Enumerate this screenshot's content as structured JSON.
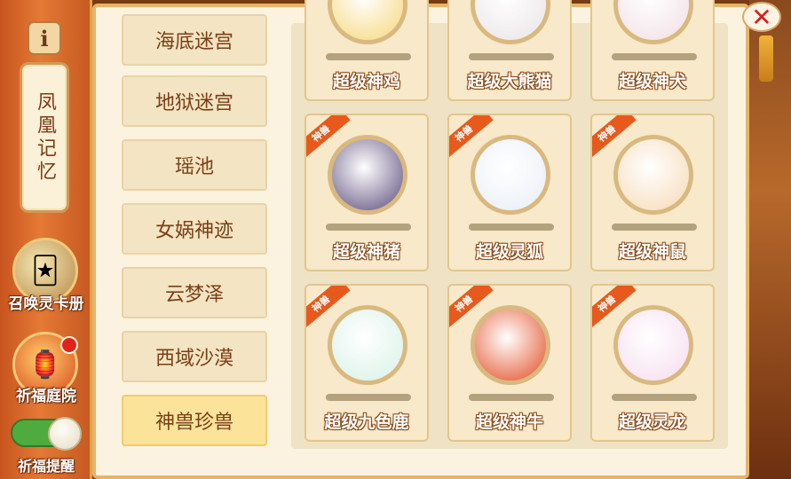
{
  "sidebar": {
    "info_icon": "info-icon",
    "scroll_title": "凤凰记忆",
    "card_book_label": "召唤灵卡册",
    "court_label": "祈福庭院",
    "remind_label": "祈福提醒",
    "remind_toggle_on": true
  },
  "close_icon_glyph": "✕",
  "categories": [
    {
      "label": "海底迷宫",
      "active": false
    },
    {
      "label": "地狱迷宫",
      "active": false
    },
    {
      "label": "瑶池",
      "active": false
    },
    {
      "label": "女娲神迹",
      "active": false
    },
    {
      "label": "云梦泽",
      "active": false
    },
    {
      "label": "西域沙漠",
      "active": false
    },
    {
      "label": "神兽珍兽",
      "active": true
    }
  ],
  "badge_text": "神兽",
  "beasts": [
    {
      "name": "超级神鸡",
      "badge": false,
      "color": "#f7d778"
    },
    {
      "name": "超级大熊猫",
      "badge": false,
      "color": "#eae4e6"
    },
    {
      "name": "超级神犬",
      "badge": false,
      "color": "#f1dfe4"
    },
    {
      "name": "超级神猪",
      "badge": true,
      "color": "#5a4a7a"
    },
    {
      "name": "超级灵狐",
      "badge": true,
      "color": "#e8eef6"
    },
    {
      "name": "超级神鼠",
      "badge": true,
      "color": "#f6d9b4"
    },
    {
      "name": "超级九色鹿",
      "badge": true,
      "color": "#d7f1e6"
    },
    {
      "name": "超级神牛",
      "badge": true,
      "color": "#e24a1f"
    },
    {
      "name": "超级灵龙",
      "badge": true,
      "color": "#f6dcee"
    }
  ]
}
